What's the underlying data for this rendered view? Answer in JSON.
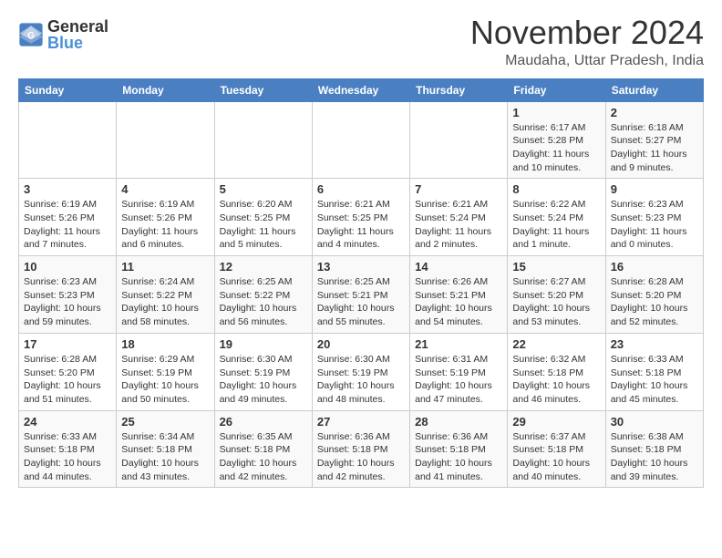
{
  "header": {
    "logo_general": "General",
    "logo_blue": "Blue",
    "month_title": "November 2024",
    "location": "Maudaha, Uttar Pradesh, India"
  },
  "weekdays": [
    "Sunday",
    "Monday",
    "Tuesday",
    "Wednesday",
    "Thursday",
    "Friday",
    "Saturday"
  ],
  "weeks": [
    [
      {
        "day": "",
        "info": ""
      },
      {
        "day": "",
        "info": ""
      },
      {
        "day": "",
        "info": ""
      },
      {
        "day": "",
        "info": ""
      },
      {
        "day": "",
        "info": ""
      },
      {
        "day": "1",
        "info": "Sunrise: 6:17 AM\nSunset: 5:28 PM\nDaylight: 11 hours and 10 minutes."
      },
      {
        "day": "2",
        "info": "Sunrise: 6:18 AM\nSunset: 5:27 PM\nDaylight: 11 hours and 9 minutes."
      }
    ],
    [
      {
        "day": "3",
        "info": "Sunrise: 6:19 AM\nSunset: 5:26 PM\nDaylight: 11 hours and 7 minutes."
      },
      {
        "day": "4",
        "info": "Sunrise: 6:19 AM\nSunset: 5:26 PM\nDaylight: 11 hours and 6 minutes."
      },
      {
        "day": "5",
        "info": "Sunrise: 6:20 AM\nSunset: 5:25 PM\nDaylight: 11 hours and 5 minutes."
      },
      {
        "day": "6",
        "info": "Sunrise: 6:21 AM\nSunset: 5:25 PM\nDaylight: 11 hours and 4 minutes."
      },
      {
        "day": "7",
        "info": "Sunrise: 6:21 AM\nSunset: 5:24 PM\nDaylight: 11 hours and 2 minutes."
      },
      {
        "day": "8",
        "info": "Sunrise: 6:22 AM\nSunset: 5:24 PM\nDaylight: 11 hours and 1 minute."
      },
      {
        "day": "9",
        "info": "Sunrise: 6:23 AM\nSunset: 5:23 PM\nDaylight: 11 hours and 0 minutes."
      }
    ],
    [
      {
        "day": "10",
        "info": "Sunrise: 6:23 AM\nSunset: 5:23 PM\nDaylight: 10 hours and 59 minutes."
      },
      {
        "day": "11",
        "info": "Sunrise: 6:24 AM\nSunset: 5:22 PM\nDaylight: 10 hours and 58 minutes."
      },
      {
        "day": "12",
        "info": "Sunrise: 6:25 AM\nSunset: 5:22 PM\nDaylight: 10 hours and 56 minutes."
      },
      {
        "day": "13",
        "info": "Sunrise: 6:25 AM\nSunset: 5:21 PM\nDaylight: 10 hours and 55 minutes."
      },
      {
        "day": "14",
        "info": "Sunrise: 6:26 AM\nSunset: 5:21 PM\nDaylight: 10 hours and 54 minutes."
      },
      {
        "day": "15",
        "info": "Sunrise: 6:27 AM\nSunset: 5:20 PM\nDaylight: 10 hours and 53 minutes."
      },
      {
        "day": "16",
        "info": "Sunrise: 6:28 AM\nSunset: 5:20 PM\nDaylight: 10 hours and 52 minutes."
      }
    ],
    [
      {
        "day": "17",
        "info": "Sunrise: 6:28 AM\nSunset: 5:20 PM\nDaylight: 10 hours and 51 minutes."
      },
      {
        "day": "18",
        "info": "Sunrise: 6:29 AM\nSunset: 5:19 PM\nDaylight: 10 hours and 50 minutes."
      },
      {
        "day": "19",
        "info": "Sunrise: 6:30 AM\nSunset: 5:19 PM\nDaylight: 10 hours and 49 minutes."
      },
      {
        "day": "20",
        "info": "Sunrise: 6:30 AM\nSunset: 5:19 PM\nDaylight: 10 hours and 48 minutes."
      },
      {
        "day": "21",
        "info": "Sunrise: 6:31 AM\nSunset: 5:19 PM\nDaylight: 10 hours and 47 minutes."
      },
      {
        "day": "22",
        "info": "Sunrise: 6:32 AM\nSunset: 5:18 PM\nDaylight: 10 hours and 46 minutes."
      },
      {
        "day": "23",
        "info": "Sunrise: 6:33 AM\nSunset: 5:18 PM\nDaylight: 10 hours and 45 minutes."
      }
    ],
    [
      {
        "day": "24",
        "info": "Sunrise: 6:33 AM\nSunset: 5:18 PM\nDaylight: 10 hours and 44 minutes."
      },
      {
        "day": "25",
        "info": "Sunrise: 6:34 AM\nSunset: 5:18 PM\nDaylight: 10 hours and 43 minutes."
      },
      {
        "day": "26",
        "info": "Sunrise: 6:35 AM\nSunset: 5:18 PM\nDaylight: 10 hours and 42 minutes."
      },
      {
        "day": "27",
        "info": "Sunrise: 6:36 AM\nSunset: 5:18 PM\nDaylight: 10 hours and 42 minutes."
      },
      {
        "day": "28",
        "info": "Sunrise: 6:36 AM\nSunset: 5:18 PM\nDaylight: 10 hours and 41 minutes."
      },
      {
        "day": "29",
        "info": "Sunrise: 6:37 AM\nSunset: 5:18 PM\nDaylight: 10 hours and 40 minutes."
      },
      {
        "day": "30",
        "info": "Sunrise: 6:38 AM\nSunset: 5:18 PM\nDaylight: 10 hours and 39 minutes."
      }
    ]
  ]
}
